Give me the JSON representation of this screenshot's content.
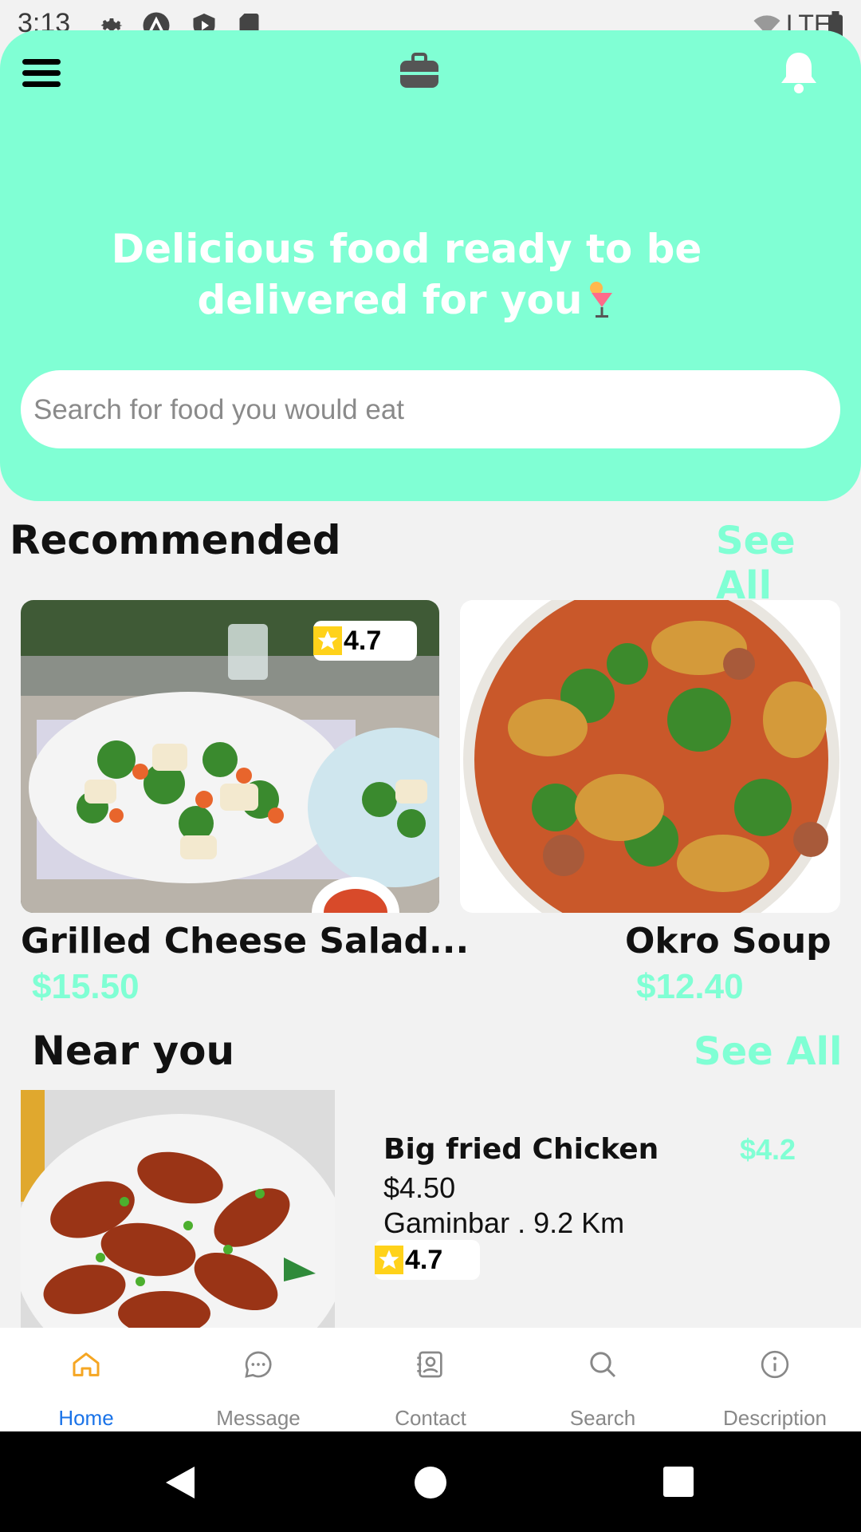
{
  "status_bar": {
    "time": "3:13",
    "network_label": "LTE"
  },
  "header": {
    "headline_line1": "Delicious food ready to be",
    "headline_line2": "delivered for you",
    "search_placeholder": "Search for food you would eat",
    "background_color": "#80ffd4"
  },
  "recommended": {
    "title": "Recommended",
    "see_all": "See All",
    "items": [
      {
        "name": "Grilled Cheese Salad...",
        "price": "$15.50",
        "rating": "4.7"
      },
      {
        "name": "Okro Soup",
        "price": "$12.40"
      }
    ]
  },
  "near_you": {
    "title": "Near you",
    "see_all": "See All",
    "items": [
      {
        "name": "Big fried Chicken",
        "side_price": "$4.2",
        "price": "$4.50",
        "location": "Gaminbar . 9.2 Km",
        "rating": "4.7"
      }
    ]
  },
  "bottom_nav": {
    "items": [
      {
        "label": "Home",
        "icon": "home-icon",
        "active": true
      },
      {
        "label": "Message",
        "icon": "message-icon"
      },
      {
        "label": "Contact",
        "icon": "contact-icon"
      },
      {
        "label": "Search",
        "icon": "search-icon"
      },
      {
        "label": "Description",
        "icon": "info-icon"
      }
    ],
    "active_color": "#1a73e8",
    "home_icon_color": "#f5a623"
  }
}
